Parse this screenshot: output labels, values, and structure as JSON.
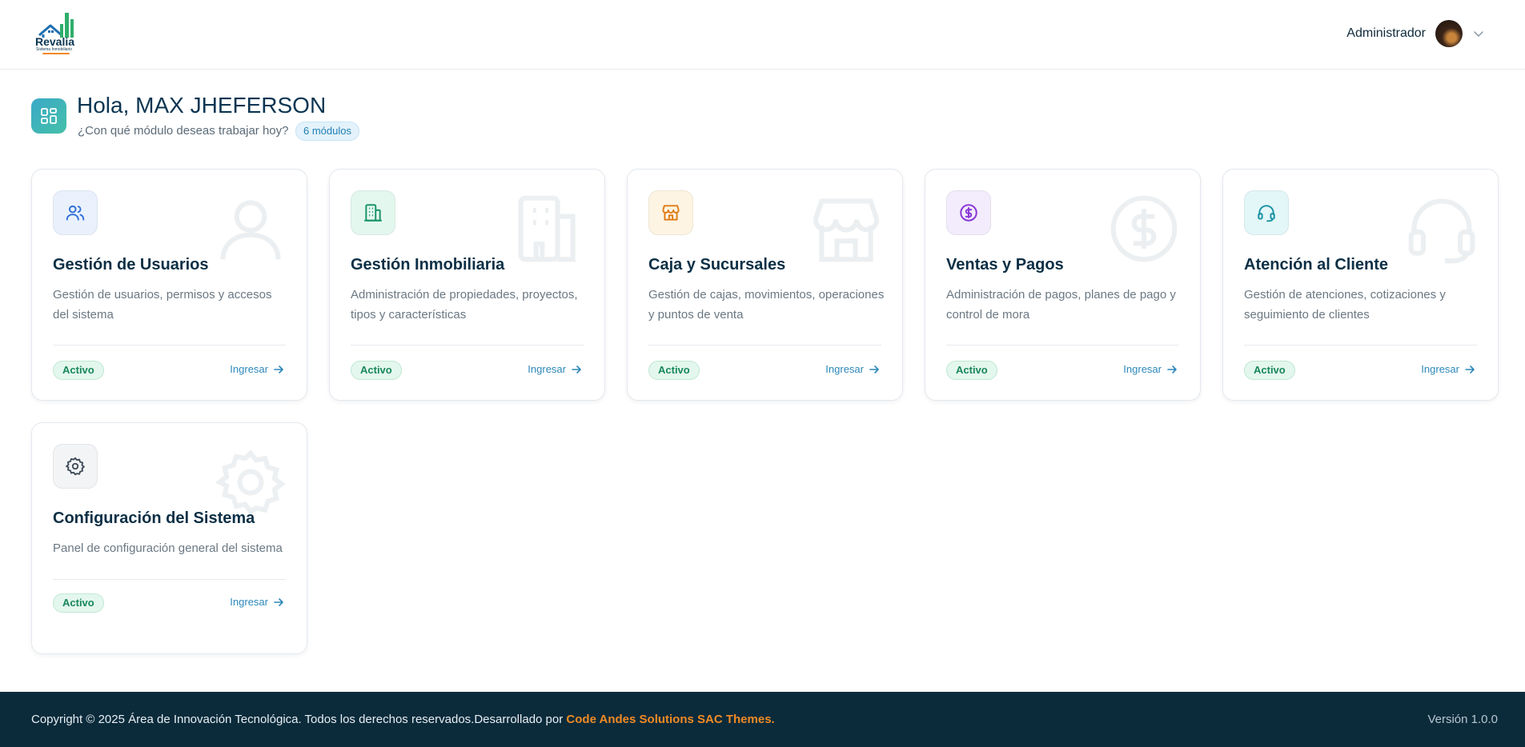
{
  "header": {
    "logo_name": "Revalia",
    "logo_subtitle": "Sistema Inmobiliario",
    "user_name": "Administrador"
  },
  "greeting": {
    "title": "Hola, MAX JHEFERSON",
    "subtitle": "¿Con qué módulo deseas trabajar hoy?",
    "module_count": "6 módulos"
  },
  "modules": [
    {
      "title": "Gestión de Usuarios",
      "description": "Gestión de usuarios, permisos y accesos del sistema",
      "status": "Activo",
      "action": "Ingresar",
      "icon": "users-icon",
      "color": "#2f6fd6",
      "bg": "#eaf1fd"
    },
    {
      "title": "Gestión Inmobiliaria",
      "description": "Administración de propiedades, proyectos, tipos y características",
      "status": "Activo",
      "action": "Ingresar",
      "icon": "building-icon",
      "color": "#17936a",
      "bg": "#e4f7ef"
    },
    {
      "title": "Caja y Sucursales",
      "description": "Gestión de cajas, movimientos, operaciones y puntos de venta",
      "status": "Activo",
      "action": "Ingresar",
      "icon": "store-icon",
      "color": "#e07b16",
      "bg": "#fdf4e3"
    },
    {
      "title": "Ventas y Pagos",
      "description": "Administración de pagos, planes de pago y control de mora",
      "status": "Activo",
      "action": "Ingresar",
      "icon": "dollar-circle-icon",
      "color": "#8a3ad6",
      "bg": "#f3ecfc"
    },
    {
      "title": "Atención al Cliente",
      "description": "Gestión de atenciones, cotizaciones y seguimiento de clientes",
      "status": "Activo",
      "action": "Ingresar",
      "icon": "headset-icon",
      "color": "#1791a3",
      "bg": "#e3f6f8"
    },
    {
      "title": "Configuración del Sistema",
      "description": "Panel de configuración general del sistema",
      "status": "Activo",
      "action": "Ingresar",
      "icon": "gear-icon",
      "color": "#3d4a56",
      "bg": "#f2f4f6"
    }
  ],
  "footer": {
    "copyright": "Copyright © 2025 Área de Innovación Tecnológica. Todos los derechos reservados.Desarrollado por ",
    "brand": "Code Andes Solutions SAC Themes.",
    "version": "Versión 1.0.0"
  },
  "colors": {
    "accent": "#2c87b8",
    "footer_bg": "#0b2b3b",
    "brand_orange": "#f08a24",
    "status_green": "#17875a"
  }
}
